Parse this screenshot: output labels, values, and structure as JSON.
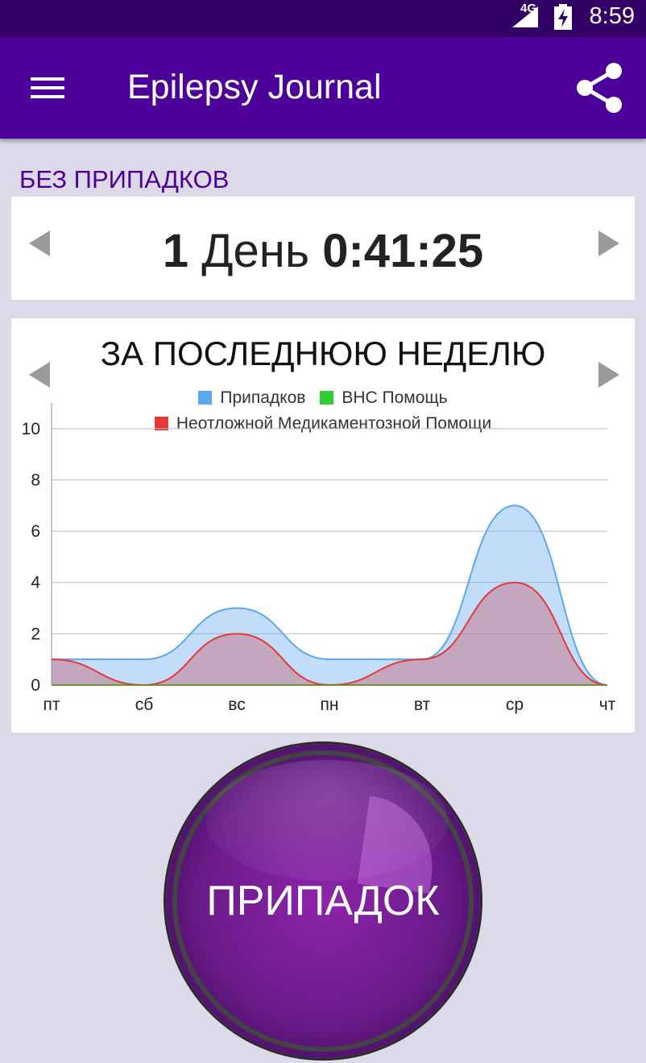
{
  "status_bar": {
    "network": "4G",
    "time": "8:59"
  },
  "app_bar": {
    "title": "Epilepsy Journal",
    "menu_icon": "hamburger-menu-icon",
    "share_icon": "share-icon"
  },
  "seizure_free": {
    "label": "БЕЗ ПРИПАДКОВ",
    "days": "1",
    "days_unit": "День",
    "time": "0:41:25"
  },
  "chart_card": {
    "title": "ЗА ПОСЛЕДНЮЮ НЕДЕЛЮ"
  },
  "chart_data": {
    "type": "area",
    "categories": [
      "пт",
      "сб",
      "вс",
      "пн",
      "вт",
      "ср",
      "чт"
    ],
    "series": [
      {
        "name": "Припадков",
        "color": "#5aa9f0",
        "values": [
          1,
          1,
          3,
          1,
          1,
          7,
          0
        ]
      },
      {
        "name": "ВНС Помощь",
        "color": "#33cc33",
        "values": [
          0,
          0,
          0,
          0,
          0,
          0,
          0
        ]
      },
      {
        "name": "Неотложной Медикаментозной Помощи",
        "color": "#e53935",
        "values": [
          1,
          0,
          2,
          0,
          1,
          4,
          0
        ]
      }
    ],
    "y_ticks": [
      "0",
      "2",
      "4",
      "6",
      "8",
      "10"
    ],
    "ylim": [
      0,
      11
    ],
    "grid": true,
    "legend_position": "top-center",
    "smooth": true
  },
  "seizure_button": {
    "label": "ПРИПАДОК"
  }
}
